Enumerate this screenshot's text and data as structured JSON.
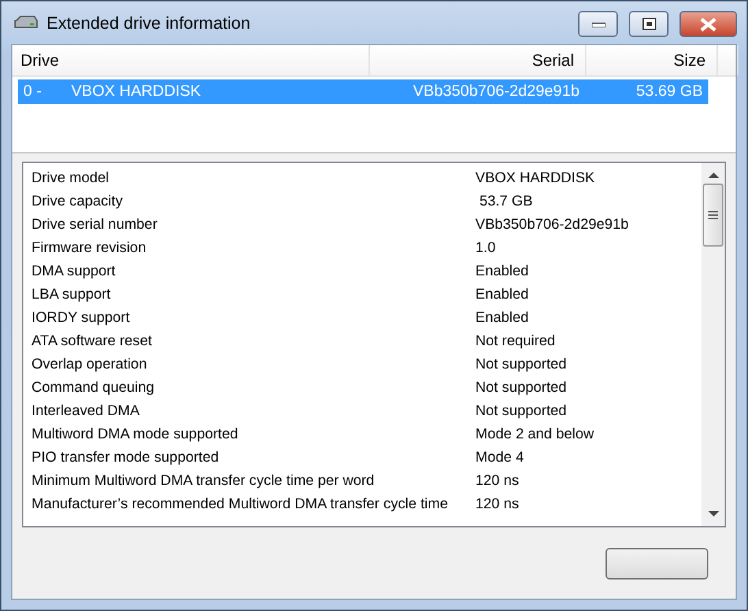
{
  "window": {
    "title": "Extended drive information"
  },
  "drives": {
    "columns": [
      "Drive",
      "Serial",
      "Size"
    ],
    "rows": [
      {
        "index": "0 -",
        "name": "VBOX HARDDISK",
        "serial": "VBb350b706-2d29e91b",
        "size": "53.69 GB",
        "selected": true
      }
    ]
  },
  "details": [
    {
      "label": "Drive model",
      "value": "VBOX HARDDISK"
    },
    {
      "label": "Drive capacity",
      "value": " 53.7 GB"
    },
    {
      "label": "Drive serial number",
      "value": "VBb350b706-2d29e91b"
    },
    {
      "label": "Firmware revision",
      "value": "1.0"
    },
    {
      "label": "DMA support",
      "value": "Enabled"
    },
    {
      "label": "LBA support",
      "value": "Enabled"
    },
    {
      "label": "IORDY support",
      "value": "Enabled"
    },
    {
      "label": "ATA software reset",
      "value": "Not required"
    },
    {
      "label": "Overlap operation",
      "value": "Not supported"
    },
    {
      "label": "Command queuing",
      "value": "Not supported"
    },
    {
      "label": "Interleaved DMA",
      "value": "Not supported"
    },
    {
      "label": "Multiword DMA mode supported",
      "value": "Mode 2 and below"
    },
    {
      "label": "PIO transfer mode supported",
      "value": "Mode 4"
    },
    {
      "label": "Minimum Multiword DMA transfer cycle time per word",
      "value": "120 ns"
    },
    {
      "label": "Manufacturer’s recommended Multiword DMA transfer cycle time",
      "value": "120 ns"
    }
  ]
}
